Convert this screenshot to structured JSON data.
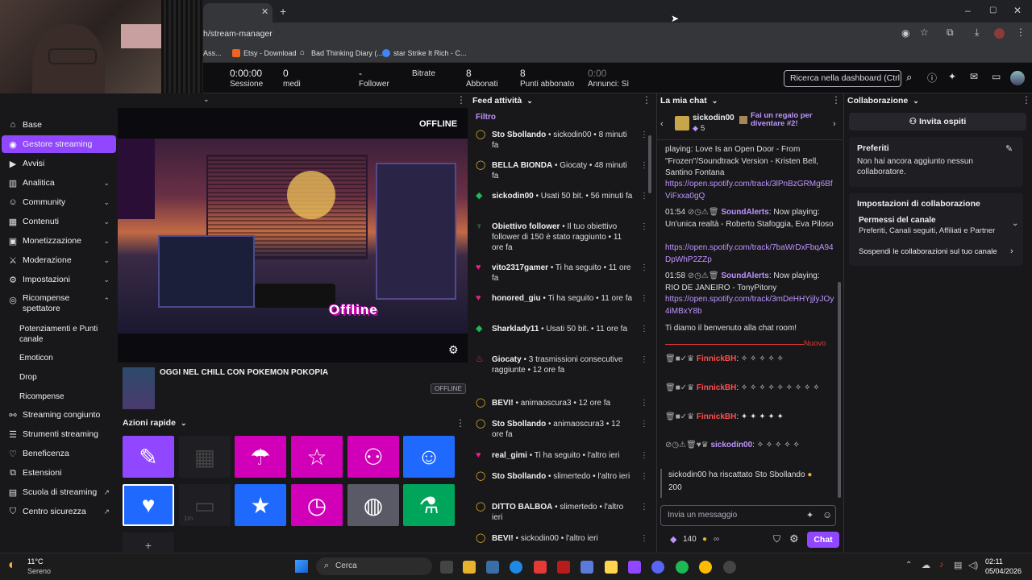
{
  "browser": {
    "url": "h/stream-manager",
    "bookmarks": [
      "Ass...",
      "Etsy - Download",
      "Bad Thinking Diary (...",
      "star Strike It Rich - C..."
    ]
  },
  "stats": [
    {
      "value": "0:00:00",
      "label": "Sessione"
    },
    {
      "value": "0",
      "label": "medi"
    },
    {
      "value": "-",
      "label": "Follower"
    },
    {
      "value": "",
      "label": "Bitrate"
    },
    {
      "value": "8",
      "label": "Abbonati"
    },
    {
      "value": "8",
      "label": "Punti abbonato"
    },
    {
      "value": "0:00",
      "label": "Annunci: Sì"
    }
  ],
  "search": {
    "placeholder": "Ricerca nella dashboard (Ctrl + ."
  },
  "sidebar": {
    "items": [
      {
        "label": "Base",
        "icon": "home-icon"
      },
      {
        "label": "Gestore streaming",
        "icon": "broadcast-icon",
        "active": true
      },
      {
        "label": "Avvisi",
        "icon": "bell-icon"
      },
      {
        "label": "Analitica",
        "icon": "chart-icon"
      },
      {
        "label": "Community",
        "icon": "people-icon"
      },
      {
        "label": "Contenuti",
        "icon": "content-icon"
      },
      {
        "label": "Monetizzazione",
        "icon": "money-icon"
      },
      {
        "label": "Moderazione",
        "icon": "sword-icon"
      },
      {
        "label": "Impostazioni",
        "icon": "gear-icon"
      },
      {
        "label": "Ricompense spettatore",
        "icon": "reward-icon"
      }
    ],
    "sub": [
      "Potenziamenti e Punti canale",
      "Emoticon",
      "Drop",
      "Ricompense"
    ],
    "bottom": [
      "Streaming congiunto",
      "Strumenti streaming",
      "Beneficenza",
      "Estensioni",
      "Scuola di streaming",
      "Centro sicurezza"
    ]
  },
  "preview": {
    "status": "OFFLINE",
    "overlay": "Offline"
  },
  "stream_info": {
    "title": "OGGI NEL CHILL CON POKEMON POKOPIA",
    "badge": "OFFLINE"
  },
  "quick_actions": {
    "title": "Azioni rapide",
    "small_label": "1m"
  },
  "feed": {
    "title": "Feed attività",
    "filter": "Filtro",
    "items": [
      {
        "who": "Sto Sbollando",
        "text": " • sickodin00 • 8 minuti fa",
        "icon": "coin-icon",
        "color": "#e6b422"
      },
      {
        "who": "BELLA BIONDA",
        "text": " • Giocaty • 48 minuti fa",
        "icon": "coin-icon",
        "color": "#e6b422"
      },
      {
        "who": "sickodin00",
        "text": " • Usati 50 bit. • 56 minuti fa",
        "icon": "bits-icon",
        "color": "#1db954"
      },
      {
        "who": "Obiettivo follower",
        "text": " • Il tuo obiettivo follower di 150 è stato raggiunto • 11 ore fa",
        "icon": "trophy-icon",
        "color": "#1db954"
      },
      {
        "who": "vito2317gamer",
        "text": " • Ti ha seguito • 11 ore fa",
        "icon": "heart-icon",
        "color": "#e91e8c"
      },
      {
        "who": "honored_giu",
        "text": " • Ti ha seguito • 11 ore fa",
        "icon": "heart-icon",
        "color": "#e91e8c"
      },
      {
        "who": "Sharklady11",
        "text": " • Usati 50 bit. • 11 ore fa",
        "icon": "bits-icon",
        "color": "#1db954"
      },
      {
        "who": "Giocaty",
        "text": " • 3 trasmissioni consecutive raggiunte • 12 ore fa",
        "icon": "flame-icon",
        "color": "#e53935"
      },
      {
        "who": "BEVI!",
        "text": " • animaoscura3 • 12 ore fa",
        "icon": "coin-icon",
        "color": "#e6b422"
      },
      {
        "who": "Sto Sbollando",
        "text": " • animaoscura3 • 12 ore fa",
        "icon": "coin-icon",
        "color": "#e6b422"
      },
      {
        "who": "real_gimi",
        "text": " • Ti ha seguito • l'altro ieri",
        "icon": "heart-icon",
        "color": "#e91e8c"
      },
      {
        "who": "Sto Sbollando",
        "text": " • slimertedo • l'altro ieri",
        "icon": "coin-icon",
        "color": "#e6b422"
      },
      {
        "who": "DITTO BALBOA",
        "text": " • slimertedo • l'altro ieri",
        "icon": "coin-icon",
        "color": "#e6b422"
      },
      {
        "who": "BEVI!",
        "text": " • sickodin00 • l'altro ieri",
        "icon": "coin-icon",
        "color": "#e6b422"
      }
    ]
  },
  "chat": {
    "title": "La mia chat",
    "pinned_user": "sickodin00",
    "pinned_count": "5",
    "gift_text": "Fai un regalo per diventare #2!",
    "lines": [
      {
        "text": "playing: Love Is an Open Door - From \"Frozen\"/Soundtrack Version - Kristen Bell, Santino Fontana"
      },
      {
        "link": "https://open.spotify.com/track/3lPnBzGRMg6BfViFxxa0gQ"
      },
      {
        "time": "01:54",
        "user": "SoundAlerts",
        "text": ": Now playing: Un'unica realtà - Roberto Stafoggia, Eva Piloso"
      },
      {
        "link": "https://open.spotify.com/track/7baWrDxFbqA94DpWhP2ZZp"
      },
      {
        "time": "01:58",
        "user": "SoundAlerts",
        "text": ": Now playing: RIO DE JANEIRO - TonyPitony"
      },
      {
        "link": "https://open.spotify.com/track/3mDeHHYjjlyJOy4iMBxY8b"
      },
      {
        "text": "Ti diamo il benvenuto alla chat room!"
      }
    ],
    "new_label": "Nuovo",
    "emote_users": [
      "FinnickBH",
      "FinnickBH",
      "FinnickBH",
      "sickodin00"
    ],
    "redeem": "sickodin00 ha riscattato Sto Sbollando",
    "redeem_cost": "200",
    "input_placeholder": "Invia un messaggio",
    "points": "140",
    "send": "Chat"
  },
  "collab": {
    "title": "Collaborazione",
    "invite": "Invita ospiti",
    "fav_title": "Preferiti",
    "fav_text": "Non hai ancora aggiunto nessun collaboratore.",
    "settings_title": "Impostazioni di collaborazione",
    "perm_title": "Permessi del canale",
    "perm_sub": "Preferiti, Canali seguiti, Affiliati e Partner",
    "suspend": "Sospendi le collaborazioni sul tuo canale"
  },
  "taskbar": {
    "weather_temp": "11°C",
    "weather_desc": "Sereno",
    "search": "Cerca",
    "time": "02:11",
    "date": "05/04/2026"
  },
  "colors": {
    "accent": "#9147ff",
    "magenta": "#d100b8",
    "blue": "#1f69ff",
    "green": "#00a55c"
  }
}
